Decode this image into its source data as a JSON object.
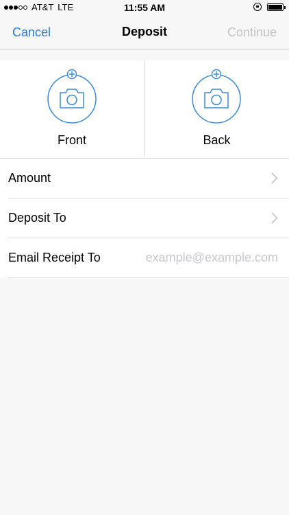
{
  "status_bar": {
    "carrier": "AT&T",
    "network": "LTE",
    "time": "11:55 AM",
    "signal_bars_filled": 3,
    "signal_bars_total": 5
  },
  "nav": {
    "cancel_label": "Cancel",
    "title": "Deposit",
    "continue_label": "Continue",
    "accent_color": "#2a7bd4",
    "disabled_color": "#c3c3c3"
  },
  "capture": {
    "front_label": "Front",
    "back_label": "Back",
    "icon": "camera-add-icon",
    "icon_color": "#3a8ad6"
  },
  "form": {
    "amount_label": "Amount",
    "deposit_to_label": "Deposit To",
    "email_label": "Email Receipt To",
    "email_placeholder": "example@example.com",
    "email_value": ""
  }
}
